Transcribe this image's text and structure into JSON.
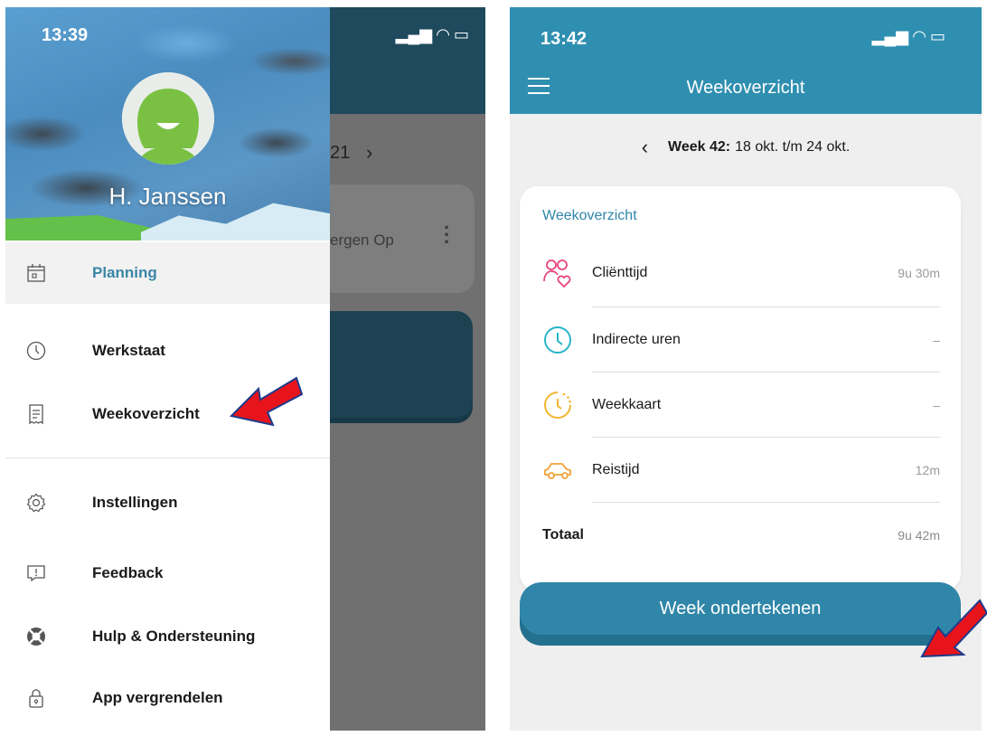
{
  "left_phone": {
    "status_time": "13:39",
    "user_name": "H. Janssen",
    "menu": {
      "planning": "Planning",
      "werkstaat": "Werkstaat",
      "weekoverzicht": "Weekoverzicht",
      "instellingen": "Instellingen",
      "feedback": "Feedback",
      "hulp": "Hulp & Ondersteuning",
      "vergrendelen": "App vergrendelen"
    },
    "background_app": {
      "date_fragment": "21",
      "next_icon": "chevron-right-icon",
      "card_text": "ergen Op"
    }
  },
  "right_phone": {
    "status_time": "13:42",
    "title": "Weekoverzicht",
    "week_label": "Week 42:",
    "week_range": "18 okt. t/m 24 okt.",
    "card_title": "Weekoverzicht",
    "rows": [
      {
        "label": "Cliënttijd",
        "value": "9u 30m",
        "icon": "clients-heart-icon"
      },
      {
        "label": "Indirecte uren",
        "value": "–",
        "icon": "clock-icon"
      },
      {
        "label": "Weekkaart",
        "value": "–",
        "icon": "timer-icon"
      },
      {
        "label": "Reistijd",
        "value": "12m",
        "icon": "car-icon"
      }
    ],
    "total": {
      "label": "Totaal",
      "value": "9u 42m"
    },
    "sign_button": "Week ondertekenen"
  },
  "colors": {
    "primary": "#2f86a8",
    "drawer_active_text": "#3a86a6",
    "annotation_arrow": "#e8141b",
    "client_icon": "#e8457a",
    "clock_icon": "#28b5c8",
    "timer_icon": "#f2b630",
    "car_icon": "#f2a33a"
  }
}
